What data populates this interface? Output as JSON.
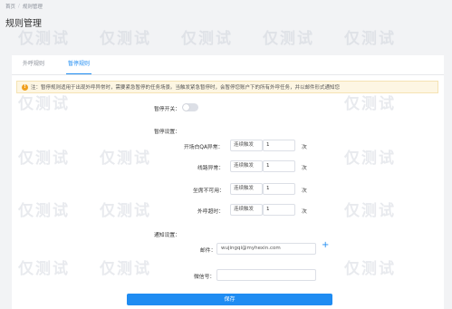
{
  "breadcrumb": {
    "home": "首页",
    "sep": "/",
    "current": "规则管理"
  },
  "page_title": "规则管理",
  "tabs": [
    {
      "label": "外呼规则",
      "active": false
    },
    {
      "label": "暂停规则",
      "active": true
    }
  ],
  "notice": {
    "icon": "warning-icon",
    "text": "注：暂停规则适用于出现外呼异常时，需要紧急暂停的任务场景。当触发紧急暂停时，会暂停您账户下的所有外呼任务，并以邮件形式通知您"
  },
  "pause_switch": {
    "label": "暂停开关：",
    "on": false
  },
  "pause_settings_label": "暂停设置：",
  "rules": [
    {
      "label": "开场白QA异常：",
      "mode": "连续触发",
      "count": "1",
      "unit": "次"
    },
    {
      "label": "线路异常：",
      "mode": "连续触发",
      "count": "1",
      "unit": "次"
    },
    {
      "label": "坐席不可用：",
      "mode": "连续触发",
      "count": "1",
      "unit": "次"
    },
    {
      "label": "外呼超时：",
      "mode": "连续触发",
      "count": "1",
      "unit": "次"
    }
  ],
  "notify_settings_label": "通知设置：",
  "email": {
    "label": "邮件：",
    "value": "wujingqi@myhexin.com"
  },
  "wechat": {
    "label": "微信号：",
    "value": ""
  },
  "save_label": "保存",
  "watermark_text": "仅测试",
  "colors": {
    "accent": "#1f8cf2",
    "notice_bg": "#fdf6e3",
    "warning": "#f0a020"
  }
}
